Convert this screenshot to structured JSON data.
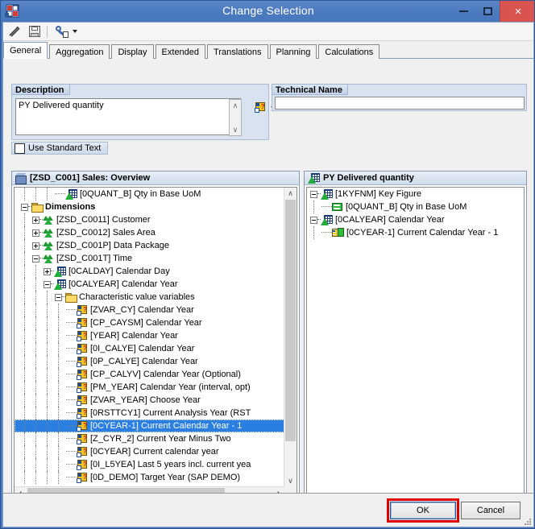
{
  "window": {
    "title": "Change Selection",
    "icon": "sap-query-icon",
    "minimize_label": "",
    "maximize_label": "",
    "close_label": "×"
  },
  "toolbar": {
    "items": [
      {
        "name": "check-wand-icon",
        "label": ""
      },
      {
        "name": "save-icon",
        "label": ""
      },
      {
        "name": "settings-wrench-icon",
        "label": ""
      }
    ]
  },
  "tabs": [
    {
      "label": "General",
      "active": true
    },
    {
      "label": "Aggregation",
      "active": false
    },
    {
      "label": "Display",
      "active": false
    },
    {
      "label": "Extended",
      "active": false
    },
    {
      "label": "Translations",
      "active": false
    },
    {
      "label": "Planning",
      "active": false
    },
    {
      "label": "Calculations",
      "active": false
    }
  ],
  "description": {
    "group_title": "Description",
    "value": "PY Delivered quantity",
    "placeholder": "",
    "variable_button": "variable-icon",
    "dropdown": "chevron-down-icon"
  },
  "technical_name": {
    "group_title": "Technical Name",
    "value": "",
    "placeholder": ""
  },
  "standard_text": {
    "label": "Use Standard Text",
    "checked": false
  },
  "left_panel": {
    "header_id": "[ZSD_C001]",
    "header_text": "Sales: Overview",
    "nodes": [
      {
        "depth": 3,
        "icon": "characteristic-icon",
        "expander": "none",
        "label": "[0QUANT_B] Qty in Base UoM",
        "bold": false,
        "selected": false
      },
      {
        "depth": 0,
        "icon": "folder-icon",
        "expander": "minus",
        "label": "Dimensions",
        "bold": true,
        "selected": false
      },
      {
        "depth": 1,
        "icon": "dimension-icon",
        "expander": "plus",
        "label": "[ZSD_C0011] Customer",
        "bold": false,
        "selected": false
      },
      {
        "depth": 1,
        "icon": "dimension-icon",
        "expander": "plus",
        "label": "[ZSD_C0012] Sales Area",
        "bold": false,
        "selected": false
      },
      {
        "depth": 1,
        "icon": "dimension-icon",
        "expander": "plus",
        "label": "[ZSD_C001P] Data Package",
        "bold": false,
        "selected": false
      },
      {
        "depth": 1,
        "icon": "dimension-icon",
        "expander": "minus",
        "label": "[ZSD_C001T] Time",
        "bold": false,
        "selected": false
      },
      {
        "depth": 2,
        "icon": "characteristic-icon",
        "expander": "plus",
        "label": "[0CALDAY] Calendar Day",
        "bold": false,
        "selected": false
      },
      {
        "depth": 2,
        "icon": "characteristic-icon",
        "expander": "minus",
        "label": "[0CALYEAR] Calendar Year",
        "bold": false,
        "selected": false
      },
      {
        "depth": 3,
        "icon": "folder-icon",
        "expander": "minus",
        "label": "Characteristic value variables",
        "bold": false,
        "selected": false
      },
      {
        "depth": 4,
        "icon": "variable-icon",
        "expander": "none",
        "label": "[ZVAR_CY] Calendar Year",
        "bold": false,
        "selected": false
      },
      {
        "depth": 4,
        "icon": "variable-icon",
        "expander": "none",
        "label": "[CP_CAYSM] Calendar Year",
        "bold": false,
        "selected": false
      },
      {
        "depth": 4,
        "icon": "variable-icon",
        "expander": "none",
        "label": "[YEAR] Calendar Year",
        "bold": false,
        "selected": false
      },
      {
        "depth": 4,
        "icon": "variable-icon",
        "expander": "none",
        "label": "[0I_CALYE] Calendar Year",
        "bold": false,
        "selected": false
      },
      {
        "depth": 4,
        "icon": "variable-icon",
        "expander": "none",
        "label": "[0P_CALYE] Calendar Year",
        "bold": false,
        "selected": false
      },
      {
        "depth": 4,
        "icon": "variable-icon",
        "expander": "none",
        "label": "[CP_CALYV] Calendar Year (Optional)",
        "bold": false,
        "selected": false
      },
      {
        "depth": 4,
        "icon": "variable-icon",
        "expander": "none",
        "label": "[PM_YEAR] Calendar Year (interval, opt)",
        "bold": false,
        "selected": false
      },
      {
        "depth": 4,
        "icon": "variable-icon",
        "expander": "none",
        "label": "[ZVAR_YEAR] Choose Year",
        "bold": false,
        "selected": false
      },
      {
        "depth": 4,
        "icon": "variable-icon",
        "expander": "none",
        "label": "[0RSTTCY1] Current Analysis Year (RST",
        "bold": false,
        "selected": false
      },
      {
        "depth": 4,
        "icon": "variable-icon",
        "expander": "none",
        "label": "[0CYEAR-1] Current Calendar Year - 1",
        "bold": false,
        "selected": true
      },
      {
        "depth": 4,
        "icon": "variable-icon",
        "expander": "none",
        "label": "[Z_CYR_2] Current Year Minus Two",
        "bold": false,
        "selected": false
      },
      {
        "depth": 4,
        "icon": "variable-icon",
        "expander": "none",
        "label": "[0CYEAR] Current calendar year",
        "bold": false,
        "selected": false
      },
      {
        "depth": 4,
        "icon": "variable-icon",
        "expander": "none",
        "label": "[0I_L5YEA] Last 5 years incl. current yea",
        "bold": false,
        "selected": false
      },
      {
        "depth": 4,
        "icon": "variable-icon",
        "expander": "none",
        "label": "[0D_DEMO] Target Year (SAP DEMO)",
        "bold": false,
        "selected": false
      }
    ]
  },
  "right_panel": {
    "header_icon": "characteristic-icon",
    "header_text": "PY Delivered quantity",
    "nodes": [
      {
        "depth": 0,
        "icon": "characteristic-icon",
        "expander": "minus",
        "label": "[1KYFNM] Key Figure",
        "selected": false
      },
      {
        "depth": 1,
        "icon": "key-figure-icon",
        "expander": "none",
        "label": "[0QUANT_B] Qty in Base UoM",
        "selected": false
      },
      {
        "depth": 0,
        "icon": "characteristic-icon",
        "expander": "minus",
        "label": "[0CALYEAR] Calendar Year",
        "selected": false
      },
      {
        "depth": 1,
        "icon": "variable-assigned-icon",
        "expander": "none",
        "label": "[0CYEAR-1] Current Calendar Year - 1",
        "selected": false
      }
    ]
  },
  "buttons": {
    "ok": "OK",
    "cancel": "Cancel"
  },
  "annotation": {
    "highlight_color": "#e00000",
    "highlight_target": "ok-button"
  },
  "scrollbars": {
    "left_vertical_up": "∧",
    "left_vertical_down": "∨",
    "left_horizontal_left": "‹",
    "left_horizontal_right": "›",
    "desc_up": "∧",
    "desc_down": "∨"
  }
}
